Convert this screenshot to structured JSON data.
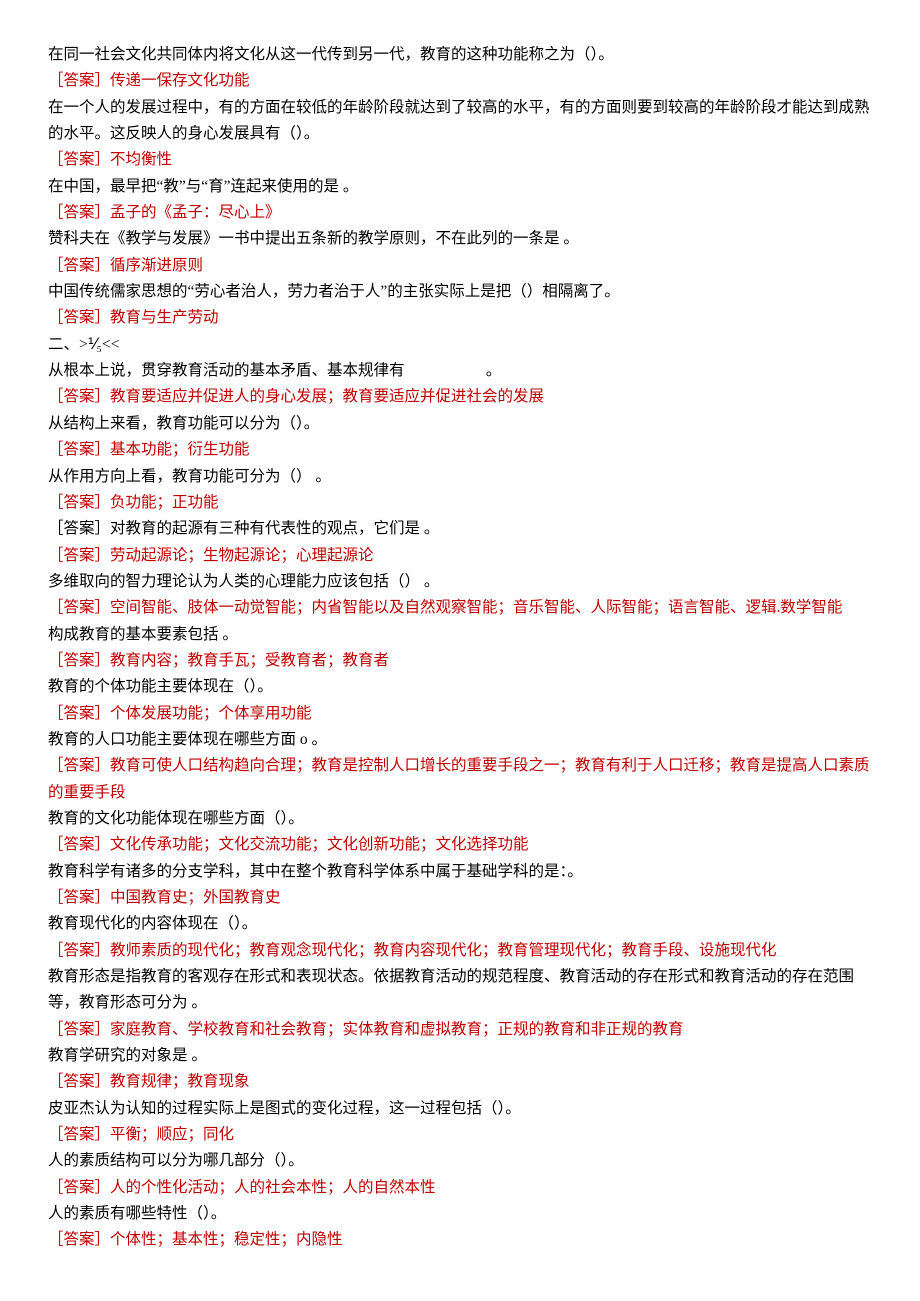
{
  "items": [
    {
      "q": "在同一社会文化共同体内将文化从这一代传到另一代，教育的这种功能称之为（）。",
      "a": "［答案］传递一保存文化功能"
    },
    {
      "q": "在一个人的发展过程中，有的方面在较低的年龄阶段就达到了较高的水平，有的方面则要到较高的年龄阶段才能达到成熟的水平。这反映人的身心发展具有（）。",
      "a": "［答案］不均衡性"
    },
    {
      "q": "在中国，最早把“教”与“育”连起来使用的是 。",
      "a": "［答案］孟子的《孟子：尽心上》"
    },
    {
      "q": "赞科夫在《教学与发展》一书中提出五条新的教学原则，不在此列的一条是 。",
      "a": "［答案］循序渐进原则"
    },
    {
      "q": "中国传统儒家思想的“劳心者治人，劳力者治于人”的主张实际上是把（）相隔离了。",
      "a": "［答案］教育与生产劳动"
    },
    {
      "q": "二、>⅟₅<<",
      "a": null
    },
    {
      "q": "从根本上说，贯穿教育活动的基本矛盾、基本规律有　　　　　 。",
      "a": "［答案］教育要适应并促进人的身心发展；教育要适应并促进社会的发展"
    },
    {
      "q": "从结构上来看，教育功能可以分为（）。",
      "a": "［答案］基本功能；衍生功能"
    },
    {
      "q": "从作用方向上看，教育功能可分为（） 。",
      "a": "［答案］负功能；正功能"
    },
    {
      "q": "［答案］对教育的起源有三种有代表性的观点，它们是 。",
      "a": "［答案］劳动起源论；生物起源论；心理起源论"
    },
    {
      "q": "多维取向的智力理论认为人类的心理能力应该包括（） 。",
      "a": "［答案］空间智能、肢体一动觉智能；内省智能以及自然观察智能；音乐智能、人际智能；语言智能、逻辑.数学智能"
    },
    {
      "q": "构成教育的基本要素包括 。",
      "a": "［答案］教育内容；教育手瓦；受教育者；教育者"
    },
    {
      "q": "教育的个体功能主要体现在（）。",
      "a": "［答案］个体发展功能；个体享用功能"
    },
    {
      "q": "教育的人口功能主要体现在哪些方面 o 。",
      "a": "［答案］教育可使人口结构趋向合理；教育是控制人口增长的重要手段之一；教育有利于人口迁移；教育是提高人口素质的重要手段"
    },
    {
      "q": "教育的文化功能体现在哪些方面（）。",
      "a": "［答案］文化传承功能；文化交流功能；文化创新功能；文化选择功能"
    },
    {
      "q": "教育科学有诸多的分支学科，其中在整个教育科学体系中属于基础学科的是：。",
      "a": "［答案］中国教育史；外国教育史"
    },
    {
      "q": "教育现代化的内容体现在（）。",
      "a": "［答案］教师素质的现代化；教育观念现代化；教育内容现代化；教育管理现代化；教育手段、设施现代化"
    },
    {
      "q": "教育形态是指教育的客观存在形式和表现状态。依据教育活动的规范程度、教育活动的存在形式和教育活动的存在范围等，教育形态可分为 。",
      "a": "［答案］家庭教育、学校教育和社会教育；实体教育和虚拟教育；正规的教育和非正规的教育"
    },
    {
      "q": "教育学研究的对象是 。",
      "a": "［答案］教育规律；教育现象"
    },
    {
      "q": "皮亚杰认为认知的过程实际上是图式的变化过程，这一过程包括（）。",
      "a": "［答案］平衡；顺应；同化"
    },
    {
      "q": "人的素质结构可以分为哪几部分（）。",
      "a": "［答案］人的个性化活动；人的社会本性；人的自然本性"
    },
    {
      "q": "人的素质有哪些特性（）。",
      "a": "［答案］个体性；基本性；稳定性；内隐性"
    }
  ]
}
